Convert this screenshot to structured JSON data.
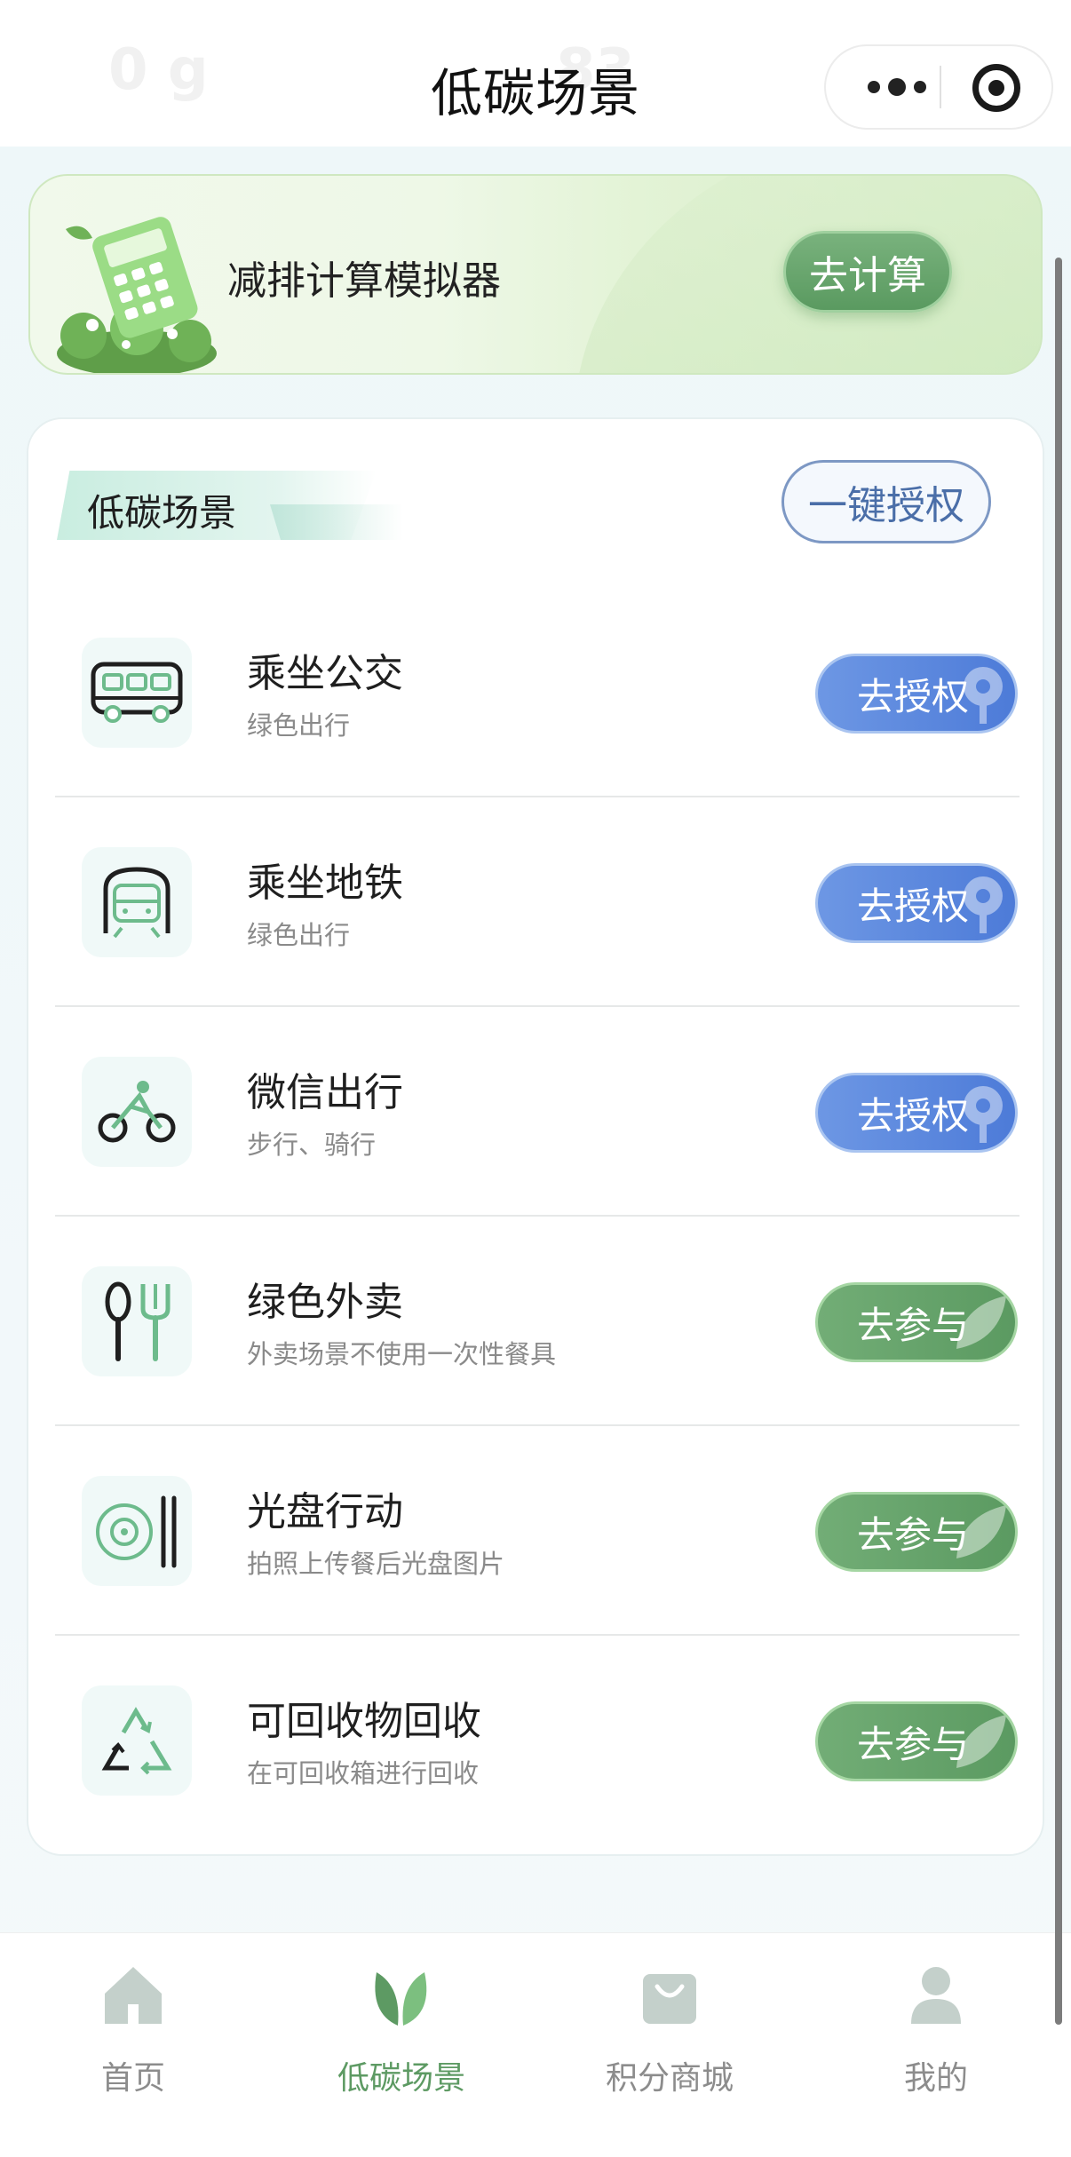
{
  "navbar": {
    "title": "低碳场景",
    "ghost_left": "0 g",
    "ghost_right": "83",
    "more_icon": "more-dots-icon",
    "target_icon": "target-icon"
  },
  "banner": {
    "text": "减排计算模拟器",
    "button": "去计算",
    "illustration": "calculator-plants"
  },
  "section": {
    "title": "低碳场景",
    "auth_all": "一键授权"
  },
  "scenes": [
    {
      "title": "乘坐公交",
      "subtitle": "绿色出行",
      "action": "去授权",
      "icon": "bus-icon",
      "type": "auth"
    },
    {
      "title": "乘坐地铁",
      "subtitle": "绿色出行",
      "action": "去授权",
      "icon": "metro-icon",
      "type": "auth"
    },
    {
      "title": "微信出行",
      "subtitle": "步行、骑行",
      "action": "去授权",
      "icon": "bicycle-icon",
      "type": "auth"
    },
    {
      "title": "绿色外卖",
      "subtitle": "外卖场景不使用一次性餐具",
      "action": "去参与",
      "icon": "spoon-fork-icon",
      "type": "join"
    },
    {
      "title": "光盘行动",
      "subtitle": "拍照上传餐后光盘图片",
      "action": "去参与",
      "icon": "plate-chopsticks-icon",
      "type": "join"
    },
    {
      "title": "可回收物回收",
      "subtitle": "在可回收箱进行回收",
      "action": "去参与",
      "icon": "recycle-icon",
      "type": "join"
    }
  ],
  "tabs": [
    {
      "label": "首页",
      "icon": "home-icon",
      "active": false
    },
    {
      "label": "低碳场景",
      "icon": "leaf-icon",
      "active": true
    },
    {
      "label": "积分商城",
      "icon": "shopping-bag-icon",
      "active": false
    },
    {
      "label": "我的",
      "icon": "user-icon",
      "active": false
    }
  ],
  "colors": {
    "accent_green": "#5d9a63",
    "auth_blue": "#5a85dc",
    "background": "#f1f8f9"
  }
}
